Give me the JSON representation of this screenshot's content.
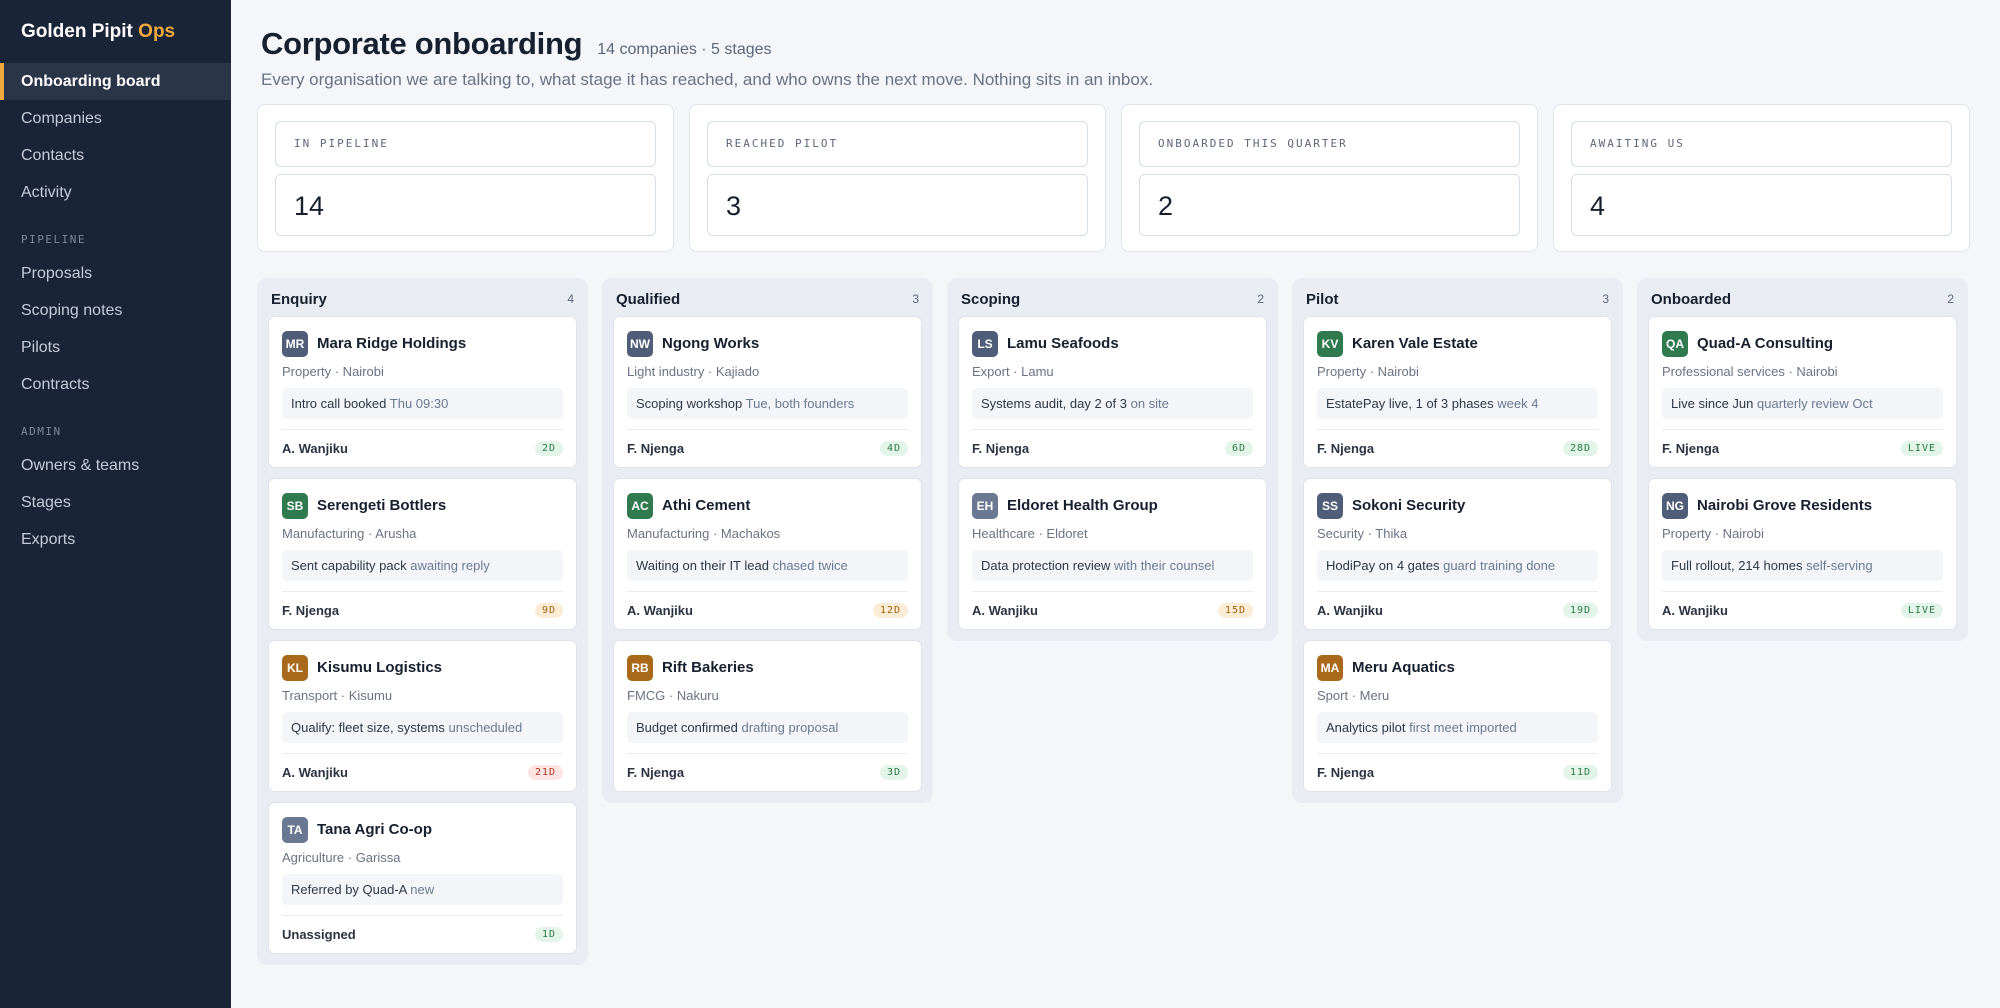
{
  "brand": {
    "name": "Golden Pipit",
    "accent": "Ops"
  },
  "nav": {
    "main": [
      {
        "label": "Onboarding board",
        "active": true
      },
      {
        "label": "Companies"
      },
      {
        "label": "Contacts"
      },
      {
        "label": "Activity"
      }
    ],
    "pipeline_label": "PIPELINE",
    "pipeline": [
      {
        "label": "Proposals"
      },
      {
        "label": "Scoping notes"
      },
      {
        "label": "Pilots"
      },
      {
        "label": "Contracts"
      }
    ],
    "admin_label": "ADMIN",
    "admin": [
      {
        "label": "Owners & teams"
      },
      {
        "label": "Stages"
      },
      {
        "label": "Exports"
      }
    ]
  },
  "header": {
    "title": "Corporate onboarding",
    "meta": "14 companies · 5 stages",
    "subtitle": "Every organisation we are talking to, what stage it has reached, and who owns the next move. Nothing sits in an inbox."
  },
  "stats": [
    {
      "label": "IN PIPELINE",
      "value": "14"
    },
    {
      "label": "REACHED PILOT",
      "value": "3"
    },
    {
      "label": "ONBOARDED THIS QUARTER",
      "value": "2"
    },
    {
      "label": "AWAITING US",
      "value": "4"
    }
  ],
  "colors": {
    "avatar_slate": "#4f5d78",
    "avatar_green": "#2f7a4e",
    "avatar_amber": "#a8691a",
    "avatar_grey": "#6b7891",
    "accent": "#f0a93c"
  },
  "columns": [
    {
      "title": "Enquiry",
      "count": "4",
      "cards": [
        {
          "initials": "MR",
          "avatar": "#4f5d78",
          "company": "Mara Ridge Holdings",
          "meta": "Property · Nairobi",
          "note": "Intro call booked",
          "note_dim": "Thu 09:30",
          "owner": "A. Wanjiku",
          "badge": "2D",
          "badge_tone": "green"
        },
        {
          "initials": "SB",
          "avatar": "#2f7a4e",
          "company": "Serengeti Bottlers",
          "meta": "Manufacturing · Arusha",
          "note": "Sent capability pack",
          "note_dim": "awaiting reply",
          "owner": "F. Njenga",
          "badge": "9D",
          "badge_tone": "amber"
        },
        {
          "initials": "KL",
          "avatar": "#a8691a",
          "company": "Kisumu Logistics",
          "meta": "Transport · Kisumu",
          "note": "Qualify: fleet size, systems",
          "note_dim": "unscheduled",
          "owner": "A. Wanjiku",
          "badge": "21D",
          "badge_tone": "red"
        },
        {
          "initials": "TA",
          "avatar": "#6b7891",
          "company": "Tana Agri Co-op",
          "meta": "Agriculture · Garissa",
          "note": "Referred by Quad-A",
          "note_dim": "new",
          "owner": "Unassigned",
          "badge": "1D",
          "badge_tone": "green"
        }
      ]
    },
    {
      "title": "Qualified",
      "count": "3",
      "cards": [
        {
          "initials": "NW",
          "avatar": "#4f5d78",
          "company": "Ngong Works",
          "meta": "Light industry · Kajiado",
          "note": "Scoping workshop",
          "note_dim": "Tue, both founders",
          "owner": "F. Njenga",
          "badge": "4D",
          "badge_tone": "green"
        },
        {
          "initials": "AC",
          "avatar": "#2f7a4e",
          "company": "Athi Cement",
          "meta": "Manufacturing · Machakos",
          "note": "Waiting on their IT lead",
          "note_dim": "chased twice",
          "owner": "A. Wanjiku",
          "badge": "12D",
          "badge_tone": "amber"
        },
        {
          "initials": "RB",
          "avatar": "#a8691a",
          "company": "Rift Bakeries",
          "meta": "FMCG · Nakuru",
          "note": "Budget confirmed",
          "note_dim": "drafting proposal",
          "owner": "F. Njenga",
          "badge": "3D",
          "badge_tone": "green"
        }
      ]
    },
    {
      "title": "Scoping",
      "count": "2",
      "cards": [
        {
          "initials": "LS",
          "avatar": "#4f5d78",
          "company": "Lamu Seafoods",
          "meta": "Export · Lamu",
          "note": "Systems audit, day 2 of 3",
          "note_dim": "on site",
          "owner": "F. Njenga",
          "badge": "6D",
          "badge_tone": "green"
        },
        {
          "initials": "EH",
          "avatar": "#6b7891",
          "company": "Eldoret Health Group",
          "meta": "Healthcare · Eldoret",
          "note": "Data protection review",
          "note_dim": "with their counsel",
          "owner": "A. Wanjiku",
          "badge": "15D",
          "badge_tone": "amber"
        }
      ]
    },
    {
      "title": "Pilot",
      "count": "3",
      "cards": [
        {
          "initials": "KV",
          "avatar": "#2f7a4e",
          "company": "Karen Vale Estate",
          "meta": "Property · Nairobi",
          "note": "EstatePay live, 1 of 3 phases",
          "note_dim": "week 4",
          "owner": "F. Njenga",
          "badge": "28D",
          "badge_tone": "green"
        },
        {
          "initials": "SS",
          "avatar": "#4f5d78",
          "company": "Sokoni Security",
          "meta": "Security · Thika",
          "note": "HodiPay on 4 gates",
          "note_dim": "guard training done",
          "owner": "A. Wanjiku",
          "badge": "19D",
          "badge_tone": "green"
        },
        {
          "initials": "MA",
          "avatar": "#a8691a",
          "company": "Meru Aquatics",
          "meta": "Sport · Meru",
          "note": "Analytics pilot",
          "note_dim": "first meet imported",
          "owner": "F. Njenga",
          "badge": "11D",
          "badge_tone": "green"
        }
      ]
    },
    {
      "title": "Onboarded",
      "count": "2",
      "cards": [
        {
          "initials": "QA",
          "avatar": "#2f7a4e",
          "company": "Quad-A Consulting",
          "meta": "Professional services · Nairobi",
          "note": "Live since Jun",
          "note_dim": "quarterly review Oct",
          "owner": "F. Njenga",
          "badge": "LIVE",
          "badge_tone": "green"
        },
        {
          "initials": "NG",
          "avatar": "#4f5d78",
          "company": "Nairobi Grove Residents",
          "meta": "Property · Nairobi",
          "note": "Full rollout, 214 homes",
          "note_dim": "self-serving",
          "owner": "A. Wanjiku",
          "badge": "LIVE",
          "badge_tone": "green"
        }
      ]
    }
  ]
}
